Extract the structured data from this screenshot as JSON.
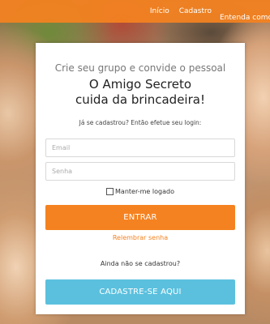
{
  "nav": {
    "items": [
      "Início",
      "Cadastro",
      "Entenda como"
    ]
  },
  "card": {
    "tagline": "Crie seu grupo e convide o pessoal",
    "headline_line1": "O Amigo Secreto",
    "headline_line2": "cuida da brincadeira!",
    "login_prompt": "Já se cadastrou? Então efetue seu login:",
    "email_placeholder": "Email",
    "senha_placeholder": "Senha",
    "remember_label": "Manter-me logado",
    "remember_checked": false,
    "login_button": "ENTRAR",
    "forgot_link": "Relembrar senha",
    "not_registered": "Ainda não se cadastrou?",
    "signup_button": "CADASTRE-SE AQUI"
  },
  "colors": {
    "accent": "#f58220",
    "signup": "#5bc0de"
  }
}
